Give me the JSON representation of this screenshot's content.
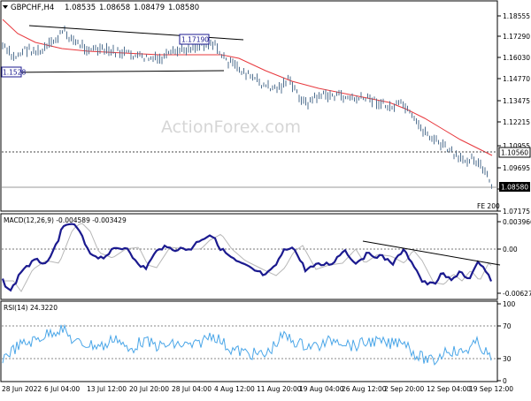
{
  "symbol": {
    "name": "GBPCHF,H4",
    "open": "1.08535",
    "high": "1.08658",
    "low": "1.08479",
    "close": "1.08580"
  },
  "watermark": "ActionForex.com",
  "price_axis": {
    "ticks": [
      "1.18555",
      "1.17290",
      "1.16030",
      "1.14770",
      "1.13475",
      "1.12215",
      "1.10955",
      "1.09695",
      "1.08435",
      "1.07175"
    ]
  },
  "labels": {
    "h_line_value": "1.10560",
    "current_price": "1.08580",
    "box_high": "1.17190",
    "box_low": "1.1528",
    "fe_label": "FE 200"
  },
  "macd": {
    "title": "MACD(12,26,9) -0.004589 -0.003429",
    "ticks": [
      "0.003966",
      "0.00",
      "-0.006276"
    ]
  },
  "rsi": {
    "title": "RSI(14) 24.3220",
    "ticks": [
      "100",
      "70",
      "30",
      "0"
    ]
  },
  "time_axis": {
    "labels": [
      "28 Jun 2022",
      "6 Jul 04:00",
      "13 Jul 12:00",
      "20 Jul 20:00",
      "28 Jul 04:00",
      "4 Aug 12:00",
      "11 Aug 20:00",
      "19 Aug 04:00",
      "26 Aug 12:00",
      "2 Sep 20:00",
      "12 Sep 04:00",
      "19 Sep 12:00"
    ]
  },
  "colors": {
    "candle": "#4f6f8f",
    "ma": "#e8383d",
    "macd": "#1b1a8f",
    "signal": "#b8b8b8",
    "rsi": "#4aa6e8",
    "grid_frame": "#000000",
    "watermark": "#d6d6d6"
  }
}
